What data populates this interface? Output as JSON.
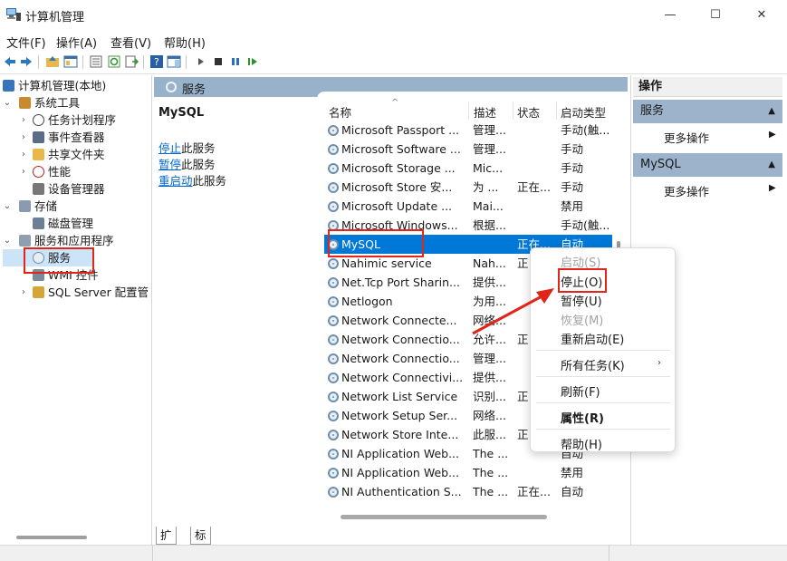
{
  "window": {
    "title": "计算机管理",
    "minimize": "—",
    "maximize": "☐",
    "close": "✕"
  },
  "menu": [
    "文件(F)",
    "操作(A)",
    "查看(V)",
    "帮助(H)"
  ],
  "toolbar": {
    "icons": [
      "back-icon",
      "forward-icon",
      "up-folder-icon",
      "console-tree-icon",
      "properties-icon",
      "refresh-icon",
      "export-icon",
      "help-icon",
      "show-pane-icon",
      "start-service-icon",
      "stop-service-icon",
      "pause-service-icon",
      "resume-service-icon"
    ]
  },
  "tree": {
    "root": "计算机管理(本地)",
    "system_tools": "系统工具",
    "task_scheduler": "任务计划程序",
    "event_viewer": "事件查看器",
    "shared_folders": "共享文件夹",
    "performance": "性能",
    "device_manager": "设备管理器",
    "storage": "存储",
    "disk_management": "磁盘管理",
    "services_apps": "服务和应用程序",
    "services": "服务",
    "wmi": "WMI 控件",
    "sql_server": "SQL Server 配置管"
  },
  "pane_header": "服务",
  "description": {
    "title": "MySQL",
    "stop_link": "停止",
    "stop_suffix": "此服务",
    "pause_link": "暂停",
    "pause_suffix": "此服务",
    "restart_link": "重启动",
    "restart_suffix": "此服务"
  },
  "columns": {
    "name": "名称",
    "desc": "描述",
    "status": "状态",
    "startup": "启动类型"
  },
  "services": [
    {
      "name": "Microsoft Passport ...",
      "desc": "管理...",
      "status": "",
      "startup": "手动(触..."
    },
    {
      "name": "Microsoft Software ...",
      "desc": "管理...",
      "status": "",
      "startup": "手动"
    },
    {
      "name": "Microsoft Storage ...",
      "desc": "Mic...",
      "status": "",
      "startup": "手动"
    },
    {
      "name": "Microsoft Store 安...",
      "desc": "为 ...",
      "status": "正在...",
      "startup": "手动"
    },
    {
      "name": "Microsoft Update ...",
      "desc": "Mai...",
      "status": "",
      "startup": "禁用"
    },
    {
      "name": "Microsoft Windows...",
      "desc": "根据...",
      "status": "",
      "startup": "手动(触..."
    },
    {
      "name": "MySQL",
      "desc": "",
      "status": "正在...",
      "startup": "自动"
    },
    {
      "name": "Nahimic service",
      "desc": "Nah...",
      "status": "正",
      "startup": ""
    },
    {
      "name": "Net.Tcp Port Sharin...",
      "desc": "提供...",
      "status": "",
      "startup": ""
    },
    {
      "name": "Netlogon",
      "desc": "为用...",
      "status": "",
      "startup": ""
    },
    {
      "name": "Network Connecte...",
      "desc": "网络...",
      "status": "",
      "startup": ""
    },
    {
      "name": "Network Connectio...",
      "desc": "允许...",
      "status": "正",
      "startup": ""
    },
    {
      "name": "Network Connectio...",
      "desc": "管理...",
      "status": "",
      "startup": ""
    },
    {
      "name": "Network Connectivi...",
      "desc": "提供...",
      "status": "",
      "startup": ""
    },
    {
      "name": "Network List Service",
      "desc": "识别...",
      "status": "正",
      "startup": ""
    },
    {
      "name": "Network Setup Ser...",
      "desc": "网络...",
      "status": "",
      "startup": ""
    },
    {
      "name": "Network Store Inte...",
      "desc": "此服...",
      "status": "正",
      "startup": ""
    },
    {
      "name": "NI Application Web...",
      "desc": "The ...",
      "status": "",
      "startup": "自动"
    },
    {
      "name": "NI Application Web...",
      "desc": "The ...",
      "status": "",
      "startup": "禁用"
    },
    {
      "name": "NI Authentication S...",
      "desc": "The ...",
      "status": "正在...",
      "startup": "自动"
    }
  ],
  "bottom_tabs": [
    "扩展",
    "标准"
  ],
  "actions": {
    "title": "操作",
    "section1": "服务",
    "section1_more": "更多操作",
    "section2": "MySQL",
    "section2_more": "更多操作"
  },
  "context_menu": {
    "start": "启动(S)",
    "stop": "停止(O)",
    "pause": "暂停(U)",
    "resume": "恢复(M)",
    "restart": "重新启动(E)",
    "all_tasks": "所有任务(K)",
    "refresh": "刷新(F)",
    "properties": "属性(R)",
    "help": "帮助(H)"
  },
  "colors": {
    "selection": "#0078d7",
    "header_band": "#98b2cc",
    "annotation_red": "#e1251b",
    "link": "#0066cc"
  }
}
